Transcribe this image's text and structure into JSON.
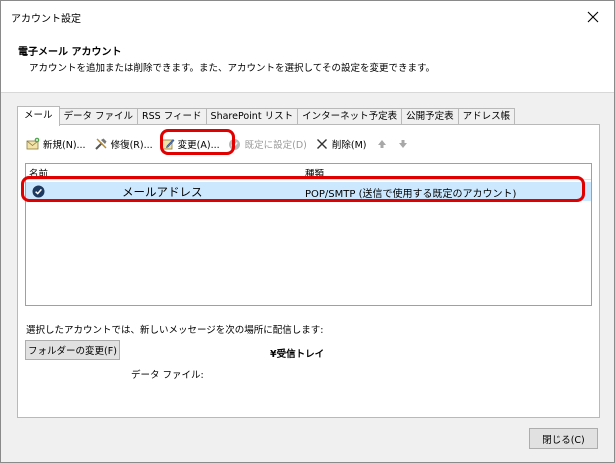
{
  "window": {
    "title": "アカウント設定"
  },
  "header": {
    "title": "電子メール アカウント",
    "subtitle": "アカウントを追加または削除できます。また、アカウントを選択してその設定を変更できます。"
  },
  "tabs": [
    {
      "label": "メール",
      "active": true
    },
    {
      "label": "データ ファイル"
    },
    {
      "label": "RSS フィード"
    },
    {
      "label": "SharePoint リスト"
    },
    {
      "label": "インターネット予定表"
    },
    {
      "label": "公開予定表"
    },
    {
      "label": "アドレス帳"
    }
  ],
  "toolbar": {
    "new_label": "新規(N)...",
    "repair_label": "修復(R)...",
    "change_label": "変更(A)...",
    "default_label": "既定に設定(D)",
    "delete_label": "削除(M)"
  },
  "list": {
    "col_name": "名前",
    "col_type": "種類",
    "rows": [
      {
        "name": "メールアドレス",
        "type": "POP/SMTP (送信で使用する既定のアカウント)"
      }
    ]
  },
  "delivery": {
    "text": "選択したアカウントでは、新しいメッセージを次の場所に配信します:",
    "folder_button": "フォルダーの変更(F)",
    "folder_name": "¥受信トレイ",
    "data_file_label": "データ ファイル:"
  },
  "footer": {
    "close_button": "閉じる(C)"
  },
  "colors": {
    "highlight": "#e00000",
    "selection": "#cce8ff",
    "check_icon": "#1f3a5f"
  }
}
